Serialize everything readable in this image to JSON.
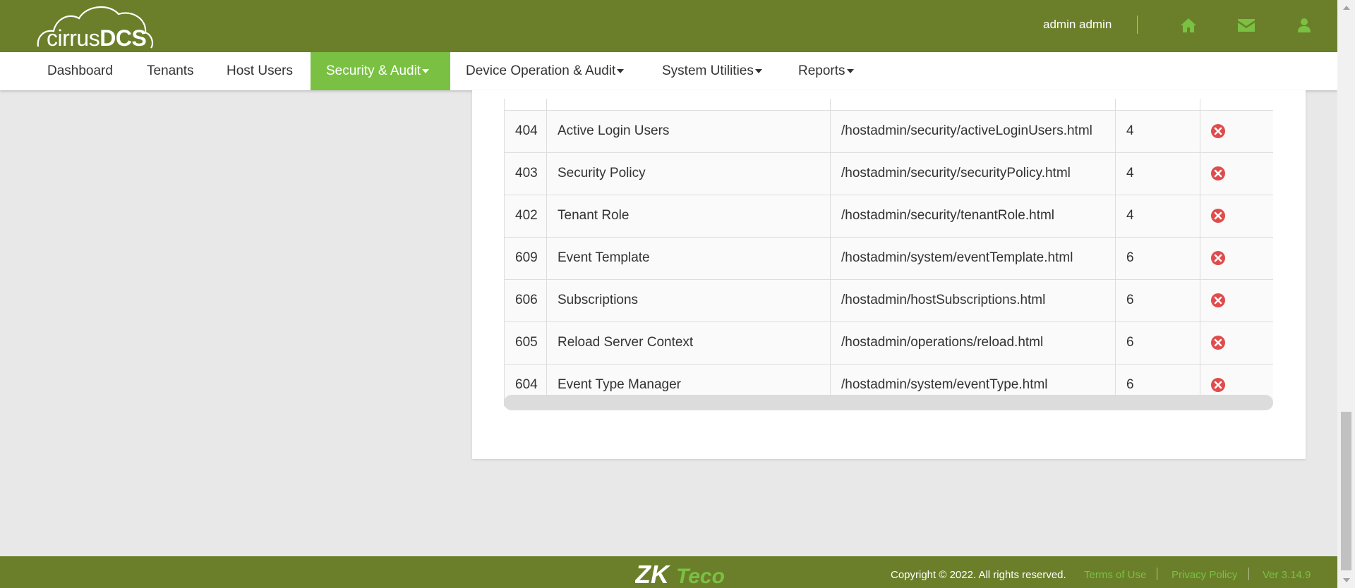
{
  "header": {
    "logo_text_main": "cirrus",
    "logo_text_accent": "DCS",
    "user_name": "admin admin",
    "icons": [
      "home-icon",
      "envelope-icon",
      "user-icon"
    ],
    "bg_color": "#6b7f2a",
    "accent_color": "#7ac143"
  },
  "nav": {
    "items": [
      {
        "label": "Dashboard",
        "active": false
      },
      {
        "label": "Tenants",
        "active": false
      },
      {
        "label": "Host Users",
        "active": false
      },
      {
        "label": "Security & Audit",
        "active": true,
        "dropdown": true
      },
      {
        "label": "Device Operation & Audit",
        "active": false,
        "dropdown": true
      },
      {
        "label": "System Utilities",
        "active": false,
        "dropdown": true
      },
      {
        "label": "Reports",
        "active": false,
        "dropdown": true
      }
    ]
  },
  "table": {
    "rows": [
      {
        "id": "404",
        "name": "Active Login Users",
        "url": "/hostadmin/security/activeLoginUsers.html",
        "level": "4"
      },
      {
        "id": "403",
        "name": "Security Policy",
        "url": "/hostadmin/security/securityPolicy.html",
        "level": "4"
      },
      {
        "id": "402",
        "name": "Tenant Role",
        "url": "/hostadmin/security/tenantRole.html",
        "level": "4"
      },
      {
        "id": "609",
        "name": "Event Template",
        "url": "/hostadmin/system/eventTemplate.html",
        "level": "6"
      },
      {
        "id": "606",
        "name": "Subscriptions",
        "url": "/hostadmin/hostSubscriptions.html",
        "level": "6"
      },
      {
        "id": "605",
        "name": "Reload Server Context",
        "url": "/hostadmin/operations/reload.html",
        "level": "6"
      },
      {
        "id": "604",
        "name": "Event Type Manager",
        "url": "/hostadmin/system/eventType.html",
        "level": "6"
      }
    ],
    "delete_icon": "remove-circle-icon",
    "delete_color": "#e04b4b"
  },
  "footer": {
    "logo_text_main": "ZK",
    "logo_text_accent": "Teco",
    "copyright": "Copyright © 2022. All rights reserved.",
    "terms": "Terms of Use",
    "privacy": "Privacy Policy",
    "version": "Ver 3.14.9"
  }
}
